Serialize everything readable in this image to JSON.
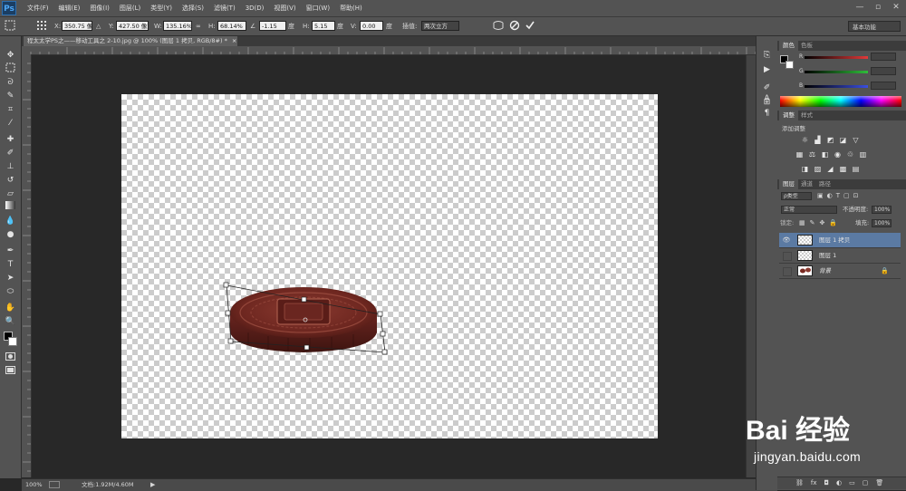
{
  "app": {
    "logo": "Ps"
  },
  "menu": [
    "文件(F)",
    "编辑(E)",
    "图像(I)",
    "图层(L)",
    "类型(Y)",
    "选择(S)",
    "滤镜(T)",
    "3D(D)",
    "视图(V)",
    "窗口(W)",
    "帮助(H)"
  ],
  "window_controls": {
    "minimize": "—",
    "restore": "▫",
    "close": "✕"
  },
  "options": {
    "x_label": "X:",
    "x_value": "350.75 像素",
    "y_label": "Y:",
    "y_value": "427.50 像素",
    "w_label": "W:",
    "w_value": "135.16%",
    "link_glyph": "∞",
    "h_label": "H:",
    "h_value": "68.14%",
    "angle_value": "-1.15",
    "angle_unit": "度",
    "hskew_label": "H:",
    "hskew_value": "5.15",
    "hskew_unit": "度",
    "vskew_label": "V:",
    "vskew_value": "0.00",
    "vskew_unit": "度",
    "interp_label": "插值:",
    "interp_value": "两次立方",
    "workspace": "基本功能"
  },
  "document": {
    "tab_title": "程太太学PS之——移动工具之 2-10.jpg @ 100% (图层 1 拷贝, RGB/8#) *",
    "tab_close": "×"
  },
  "status": {
    "zoom": "100%",
    "doc_size": "文档:1.92M/4.60M"
  },
  "panels": {
    "color_tabs": [
      "颜色",
      "色板"
    ],
    "color_channels": [
      {
        "label": "R",
        "color": "#e23a3a"
      },
      {
        "label": "G",
        "color": "#2fbd3a"
      },
      {
        "label": "B",
        "color": "#3a4ee0"
      }
    ],
    "adjust_tabs": [
      "调整",
      "样式"
    ],
    "adjust_title": "添加调整",
    "layer_tabs": [
      "图层",
      "通道",
      "路径"
    ],
    "layer_kind": "ρ类型",
    "blend_mode": "正常",
    "opacity_label": "不透明度:",
    "opacity_value": "100%",
    "lock_label": "锁定:",
    "fill_label": "填充:",
    "fill_value": "100%",
    "layers": [
      {
        "name": "图层 1 拷贝",
        "visible": true
      },
      {
        "name": "图层 1",
        "visible": false
      },
      {
        "name": "背景",
        "visible": false
      }
    ],
    "layer_footer_icons": [
      "link-icon",
      "fx-icon",
      "mask-icon",
      "adjustment-icon",
      "folder-icon",
      "new-layer-icon",
      "trash-icon"
    ]
  },
  "watermark": {
    "logo": "Bai 经验",
    "url": "jingyan.baidu.com"
  },
  "colors": {
    "accent_selected": "#5b7aa3",
    "mooncake": "#7a2a22"
  }
}
